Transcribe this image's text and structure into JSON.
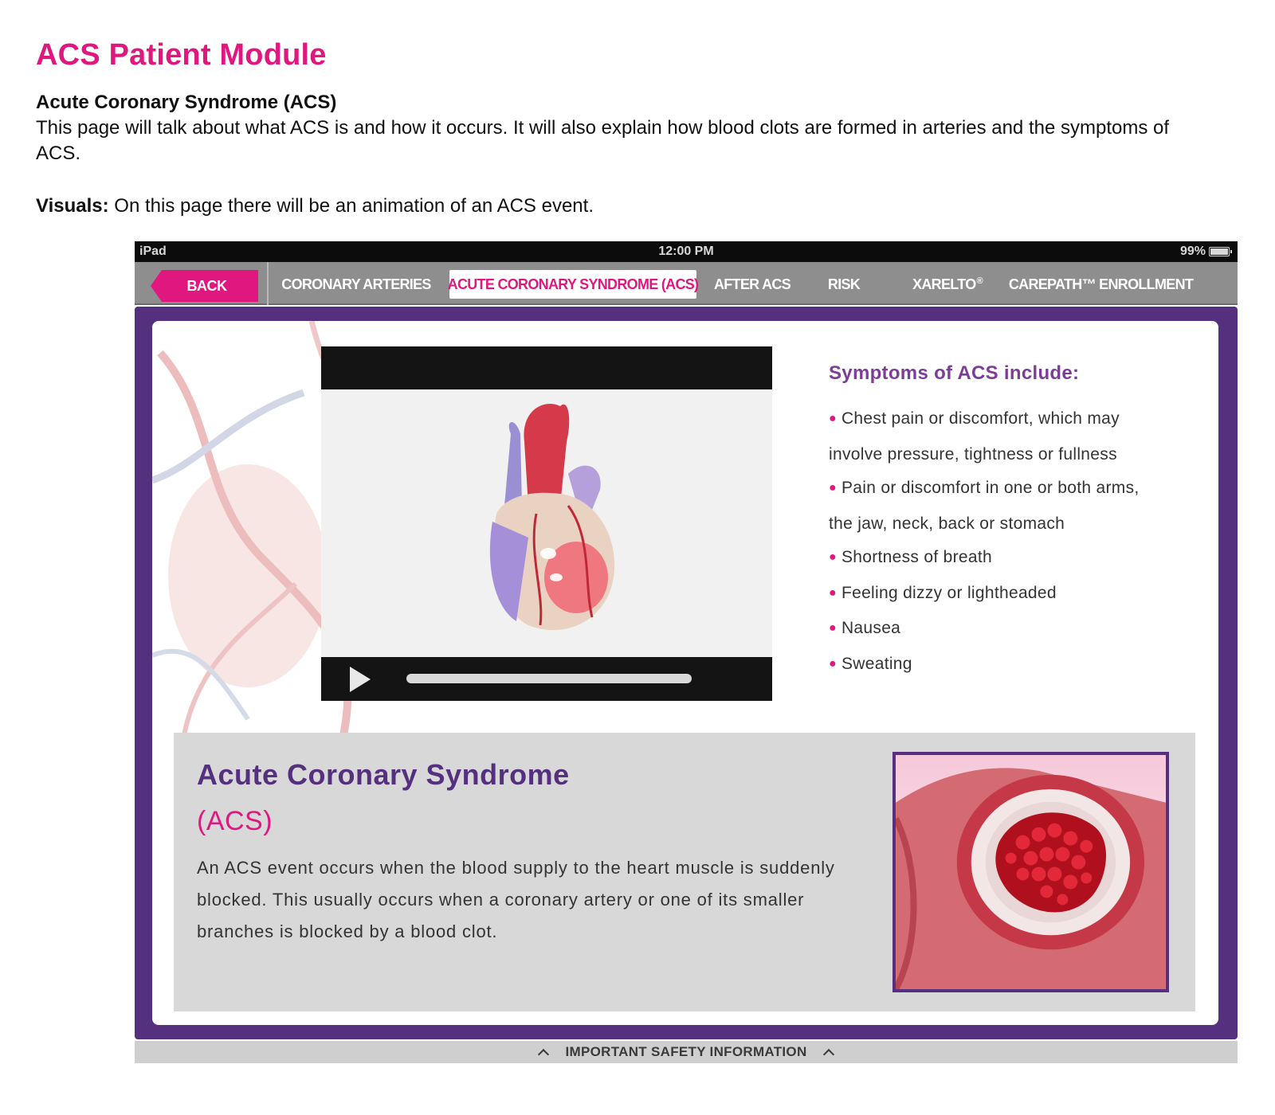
{
  "doc": {
    "title": "ACS Patient Module",
    "subtitle": "Acute Coronary Syndrome (ACS)",
    "description": "This page will talk about what ACS is and how it occurs. It will also explain how blood clots are formed in arteries and the symptoms of ACS.",
    "visuals_label": "Visuals:",
    "visuals_text": "On this page there will be an animation of an ACS event."
  },
  "status": {
    "device": "iPad",
    "time": "12:00 PM",
    "battery": "99%"
  },
  "nav": {
    "back": "BACK",
    "items": [
      {
        "label": "CORONARY ARTERIES"
      },
      {
        "label": "ACUTE CORONARY SYNDROME (ACS)",
        "active": true
      },
      {
        "label": "AFTER ACS"
      },
      {
        "label": "RISK"
      },
      {
        "label": "XARELTO",
        "sup": "®"
      },
      {
        "label": "CAREPATH™ ENROLLMENT"
      }
    ]
  },
  "symptoms": {
    "heading": "Symptoms of ACS include:",
    "items": [
      "Chest pain or discomfort, which may",
      "involve pressure, tightness or fullness",
      "Pain or discomfort in one or both arms,",
      "the jaw, neck, back or stomach",
      "Shortness of breath",
      "Feeling dizzy or lightheaded",
      "Nausea",
      "Sweating"
    ]
  },
  "info": {
    "title": "Acute Coronary Syndrome",
    "subtitle": "(ACS)",
    "text": "An ACS event occurs when the blood supply to the heart muscle is suddenly blocked. This usually occurs when a coronary artery or one of its smaller branches is blocked by a blood clot."
  },
  "footer": {
    "safety": "IMPORTANT SAFETY INFORMATION"
  },
  "colors": {
    "magenta": "#e0177e",
    "purple": "#55307f",
    "nav_gray": "#8e8e8e"
  }
}
